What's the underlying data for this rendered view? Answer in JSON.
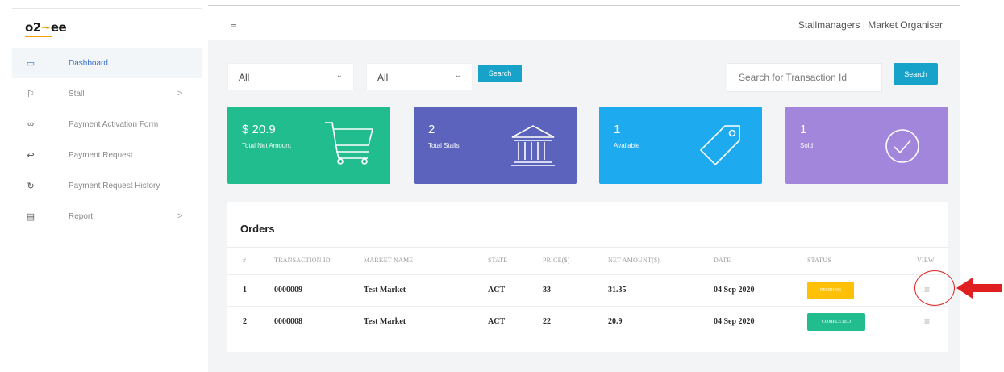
{
  "logo": {
    "o2": "o2",
    "mark": "~",
    "ee": "ee"
  },
  "sidebar": {
    "items": [
      {
        "label": "Dashboard",
        "icon": "laptop-icon",
        "glyph": "▭"
      },
      {
        "label": "Stall",
        "icon": "tag-icon",
        "glyph": "⚐",
        "chevron": ">"
      },
      {
        "label": "Payment Activation Form",
        "icon": "link-icon",
        "glyph": "∞"
      },
      {
        "label": "Payment Request",
        "icon": "reply-icon",
        "glyph": "↩"
      },
      {
        "label": "Payment Request History",
        "icon": "history-icon",
        "glyph": "↻"
      },
      {
        "label": "Report",
        "icon": "document-icon",
        "glyph": "▤",
        "chevron": ">"
      }
    ]
  },
  "header": {
    "menu_glyph": "≡",
    "user": "Stallmanagers | Market Organiser"
  },
  "filters": {
    "first": "All",
    "second": "All",
    "caret": "⌄",
    "search_label": "Search",
    "transaction_placeholder": "Search for Transaction Id",
    "transaction_search_label": "Search"
  },
  "cards": [
    {
      "value": "$ 20.9",
      "label": "Total Net Amount",
      "color": "#22bd8e",
      "icon": "cart-icon"
    },
    {
      "value": "2",
      "label": "Total Stalls",
      "color": "#5b63bd",
      "icon": "bank-icon"
    },
    {
      "value": "1",
      "label": "Available",
      "color": "#1eaaef",
      "icon": "price-tag-icon"
    },
    {
      "value": "1",
      "label": "Sold",
      "color": "#a286dc",
      "icon": "check-circle-icon"
    }
  ],
  "orders": {
    "title": "Orders",
    "columns": [
      "#",
      "TRANSACTION ID",
      "MARKET NAME",
      "STATE",
      "PRICE($)",
      "NET AMOUNT($)",
      "DATE",
      "STATUS",
      "VIEW"
    ],
    "rows": [
      {
        "num": "1",
        "txn": "0000009",
        "market": "Test Market",
        "state": "ACT",
        "price": "33",
        "net": "31.35",
        "date": "04 Sep 2020",
        "status": "PENDING",
        "status_color": "#ffc107",
        "view": "≡"
      },
      {
        "num": "2",
        "txn": "0000008",
        "market": "Test Market",
        "state": "ACT",
        "price": "22",
        "net": "20.9",
        "date": "04 Sep 2020",
        "status": "COMPLETED",
        "status_color": "#22bd8e",
        "view": "≡"
      }
    ]
  },
  "annotation": {
    "color": "#e02020"
  }
}
